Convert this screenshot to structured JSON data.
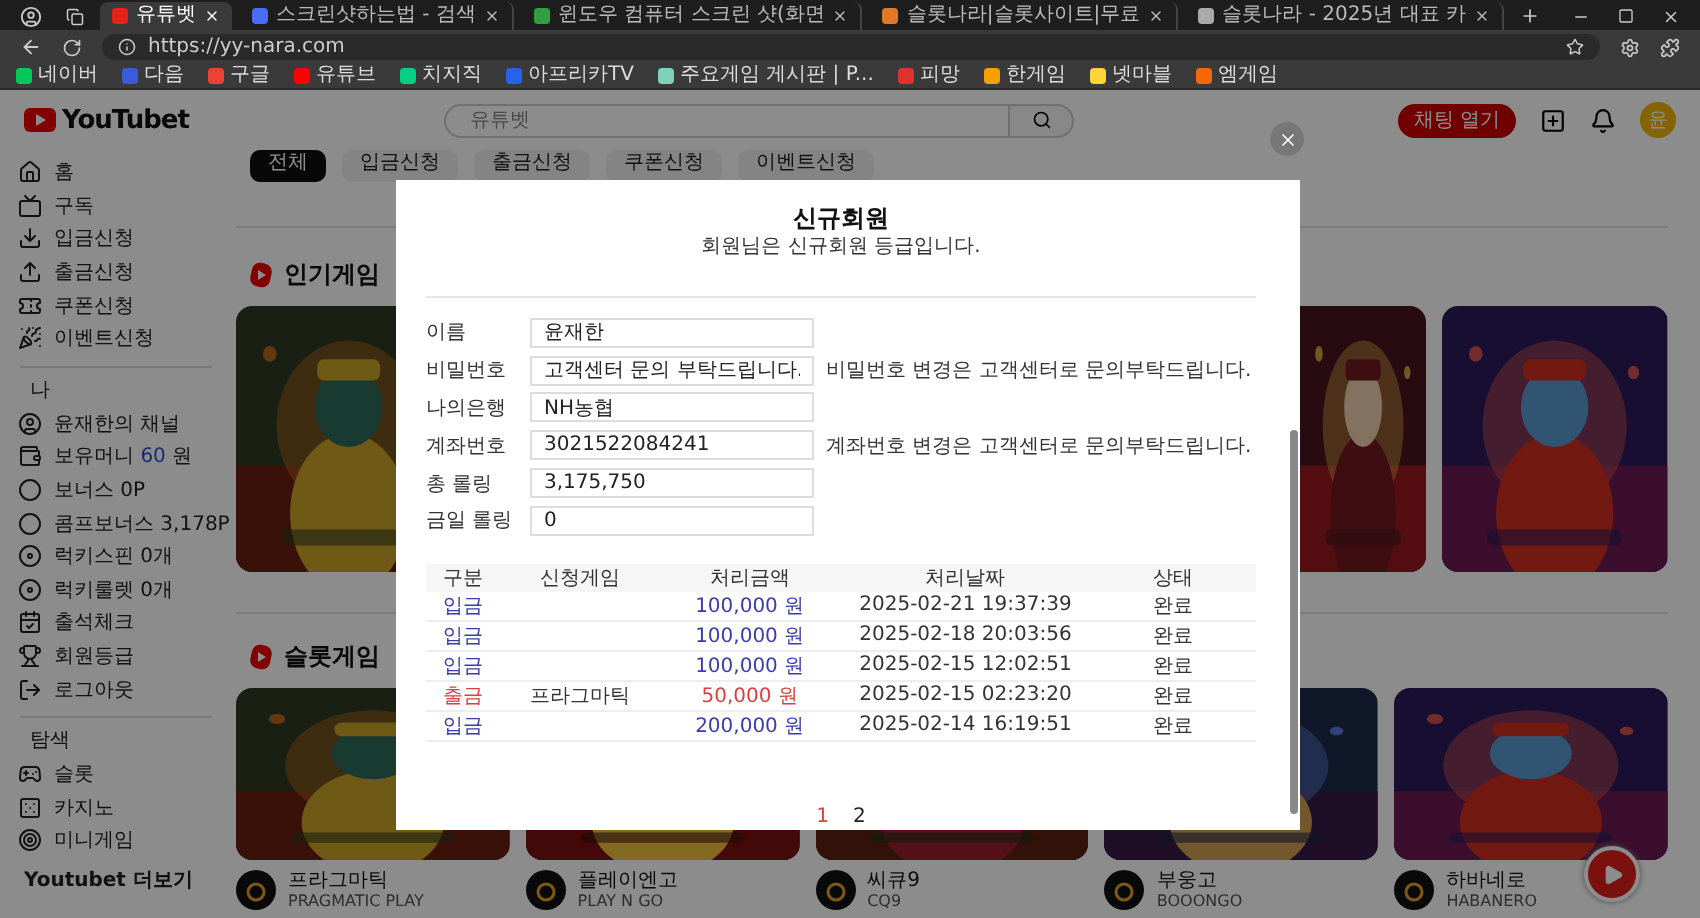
{
  "browser": {
    "tabs": [
      {
        "title": "유튜벳",
        "selected": true
      },
      {
        "title": "스크린샷하는법 - 검색",
        "selected": false
      },
      {
        "title": "윈도우 컴퓨터 스크린 샷(화면",
        "selected": false
      },
      {
        "title": "슬롯나라|슬롯사이트|무료",
        "selected": false
      },
      {
        "title": "슬롯나라 - 2025년 대표 카",
        "selected": false
      }
    ],
    "address": "https://yy-nara.com",
    "bookmarks": [
      "네이버",
      "다음",
      "구글",
      "유튜브",
      "치지직",
      "아프리카TV",
      "주요게임 게시판 | P...",
      "피망",
      "한게임",
      "넷마블",
      "엠게임"
    ]
  },
  "header": {
    "logo": "YouTubet",
    "search_placeholder": "유튜벳",
    "action_button": "채팅 열기",
    "avatar": "윤"
  },
  "sidebar": {
    "groups": [
      {
        "items": [
          {
            "label": "홈"
          },
          {
            "label": "구독"
          },
          {
            "label": "입금신청"
          },
          {
            "label": "출금신청"
          },
          {
            "label": "쿠폰신청"
          },
          {
            "label": "이벤트신청"
          }
        ]
      },
      {
        "heading": "나",
        "items": [
          {
            "label": "윤재한의 채널"
          },
          {
            "label": "보유머니",
            "amount": "60",
            "unit": "원"
          },
          {
            "label": "보너스 0P"
          },
          {
            "label": "콤프보너스 3,178P"
          },
          {
            "label": "럭키스핀 0개"
          },
          {
            "label": "럭키룰렛 0개"
          },
          {
            "label": "출석체크"
          },
          {
            "label": "회원등급"
          },
          {
            "label": "로그아웃"
          }
        ]
      },
      {
        "heading": "탐색",
        "items": [
          {
            "label": "슬롯"
          },
          {
            "label": "카지노"
          },
          {
            "label": "미니게임"
          }
        ]
      }
    ],
    "more": "Youtubet 더보기"
  },
  "chips": [
    {
      "label": "전체",
      "selected": true
    },
    {
      "label": "입금신청",
      "selected": false
    },
    {
      "label": "출금신청",
      "selected": false
    },
    {
      "label": "쿠폰신청",
      "selected": false
    },
    {
      "label": "이벤트신청",
      "selected": false
    }
  ],
  "sections": [
    {
      "title": "인기게임",
      "cards": [
        {
          "kind": "picture"
        },
        {
          "kind": "picture-edge"
        },
        {
          "kind": "picture"
        }
      ]
    },
    {
      "title": "슬롯게임",
      "cards": [
        {
          "kind": "picture",
          "name": "프라그마틱",
          "provider": "PRAGMATIC PLAY"
        },
        {
          "kind": "picture",
          "name": "플레이엔고",
          "provider": "PLAY N GO"
        },
        {
          "kind": "picture",
          "name": "씨큐9",
          "provider": "CQ9"
        },
        {
          "kind": "picture",
          "name": "부웅고",
          "provider": "BOOONGO"
        },
        {
          "kind": "picture",
          "name": "하바네로",
          "provider": "HABANERO"
        }
      ]
    }
  ],
  "modal": {
    "title": "신규회원",
    "subtitle": "회원님은 신규회원 등급입니다.",
    "fields": [
      {
        "label": "이름",
        "value": "윤재한"
      },
      {
        "label": "비밀번호",
        "value": "고객센터 문의 부탁드립니다.",
        "note": "비밀번호 변경은 고객센터로 문의부탁드립니다."
      },
      {
        "label": "나의은행",
        "value": "NH농협"
      },
      {
        "label": "계좌번호",
        "value": "3021522084241",
        "note": "계좌번호 변경은 고객센터로 문의부탁드립니다."
      },
      {
        "label": "총 롤링",
        "value": "3,175,750"
      },
      {
        "label": "금일 롤링",
        "value": "0"
      }
    ],
    "table": {
      "columns": [
        "구분",
        "신청게임",
        "처리금액",
        "처리날짜",
        "상태"
      ],
      "rows": [
        {
          "kind": "deposit",
          "type": "입금",
          "amount": "100,000 원",
          "date": "2025-02-21 19:37:39",
          "status": "완료"
        },
        {
          "kind": "deposit",
          "type": "입금",
          "amount": "100,000 원",
          "date": "2025-02-18 20:03:56",
          "status": "완료"
        },
        {
          "kind": "deposit",
          "type": "입금",
          "amount": "100,000 원",
          "date": "2025-02-15 12:02:51",
          "status": "완료"
        },
        {
          "kind": "withdraw",
          "type": "출금",
          "game": "프라그마틱",
          "amount": "50,000 원",
          "date": "2025-02-15 02:23:20",
          "status": "완료"
        },
        {
          "kind": "deposit",
          "type": "입금",
          "amount": "200,000 원",
          "date": "2025-02-14 16:19:51",
          "status": "완료"
        }
      ]
    },
    "pages": [
      {
        "label": "1",
        "selected": true
      },
      {
        "label": "2",
        "selected": false
      }
    ]
  }
}
